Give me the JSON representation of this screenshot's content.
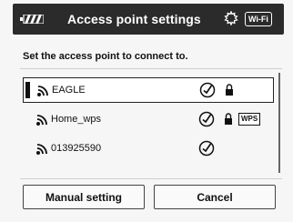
{
  "header": {
    "title": "Access point settings",
    "wifi_badge": "Wi-Fi",
    "battery_icon": "battery-icon",
    "wps_icon": "wps-gear-icon"
  },
  "prompt": "Set the access point to connect to.",
  "access_points": [
    {
      "name": "EAGLE",
      "selected": true,
      "checked": true,
      "secured": true,
      "wps": false
    },
    {
      "name": "Home_wps",
      "selected": false,
      "checked": true,
      "secured": true,
      "wps": true,
      "wps_label": "WPS"
    },
    {
      "name": "013925590",
      "selected": false,
      "checked": true,
      "secured": false,
      "wps": false
    }
  ],
  "buttons": {
    "manual": "Manual setting",
    "cancel": "Cancel"
  },
  "colors": {
    "titlebar_bg": "#2b2b2b",
    "text": "#111111",
    "background": "#f6f6f6"
  }
}
